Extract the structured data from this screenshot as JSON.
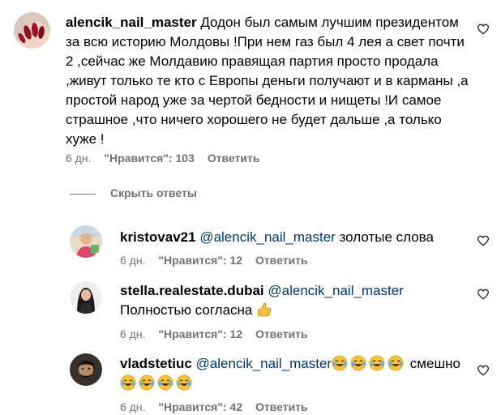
{
  "main_comment": {
    "username": "alencik_nail_master",
    "text": "Додон был самым лучшим президентом за всю историю Молдовы !При нем газ был 4 лея а свет почти 2 ,сейчас же Молдавию правящая партия просто продала ,живут только те кто с Европы деньги получают и в карманы ,а простой народ уже за чертой бедности и нищеты !И самое страшное ,что ничего хорошего не будет дальше ,а только хуже !",
    "time": "6 дн.",
    "likes": "\"Нравится\": 103",
    "reply": "Ответить"
  },
  "hide_replies": "Скрыть ответы",
  "replies": [
    {
      "username": "kristovav21",
      "mention": "@alencik_nail_master",
      "text": "золотые слова",
      "time": "6 дн.",
      "likes": "\"Нравится\": 12",
      "reply": "Ответить"
    },
    {
      "username": "stella.realestate.dubai",
      "mention": "@alencik_nail_master",
      "text": "Полностью согласна",
      "emoji": "👍",
      "time": "6 дн.",
      "likes": "\"Нравится\": 12",
      "reply": "Ответить"
    },
    {
      "username": "vladstetiuc",
      "mention": "@alencik_nail_master",
      "text": "смешно",
      "emoji": "😂",
      "time": "6 дн.",
      "likes": "\"Нравится\": 42",
      "reply": "Ответить"
    }
  ],
  "icons": {
    "like": "heart-outline-icon",
    "laugh": "face-with-tears-of-joy-emoji",
    "thumbs": "thumbs-up-emoji"
  }
}
